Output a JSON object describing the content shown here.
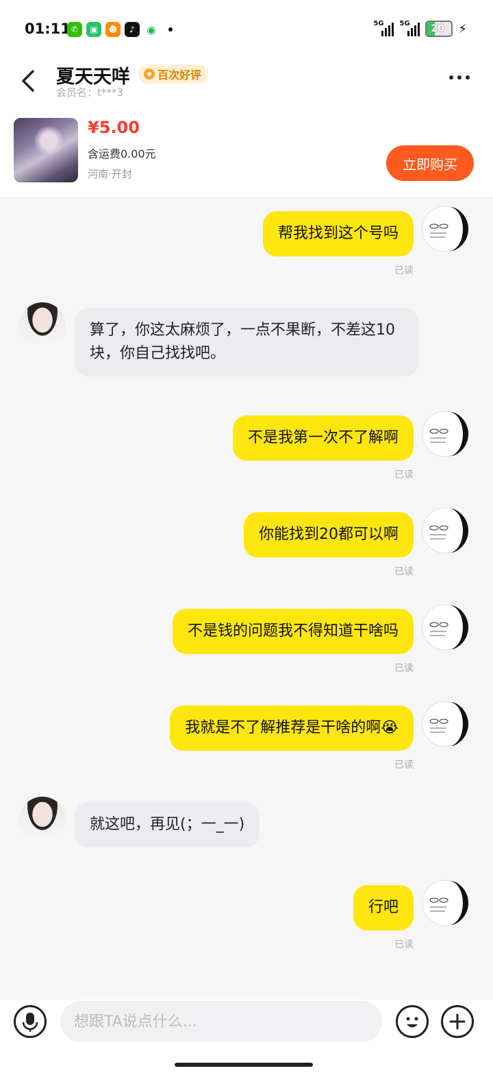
{
  "status_bar": {
    "time": "01:11",
    "signal_1": "5G",
    "signal_2": "5G",
    "battery": "20"
  },
  "header": {
    "seller_name": "夏天天咩",
    "badge": "百次好评",
    "member_id": "会员名：t***3"
  },
  "product": {
    "price": "¥5.00",
    "shipping": "含运费0.00元",
    "location": "河南·开封",
    "buy_label": "立即购买"
  },
  "messages": [
    {
      "side": "me",
      "text": "帮我找到这个号吗",
      "status": "已读"
    },
    {
      "side": "other",
      "text": "算了，你这太麻烦了，一点不果断，不差这10块，你自己找找吧。"
    },
    {
      "side": "me",
      "text": "不是我第一次不了解啊",
      "status": "已读"
    },
    {
      "side": "me",
      "text": "你能找到20都可以啊",
      "status": "已读"
    },
    {
      "side": "me",
      "text": "不是钱的问题我不得知道干啥吗",
      "status": "已读"
    },
    {
      "side": "me",
      "text": "我就是不了解推荐是干啥的啊😭",
      "status": "已读"
    },
    {
      "side": "other",
      "text": "就这吧，再见(；一_一)"
    },
    {
      "side": "me",
      "text": "行吧",
      "status": "已读"
    }
  ],
  "input": {
    "placeholder": "想跟TA说点什么..."
  }
}
